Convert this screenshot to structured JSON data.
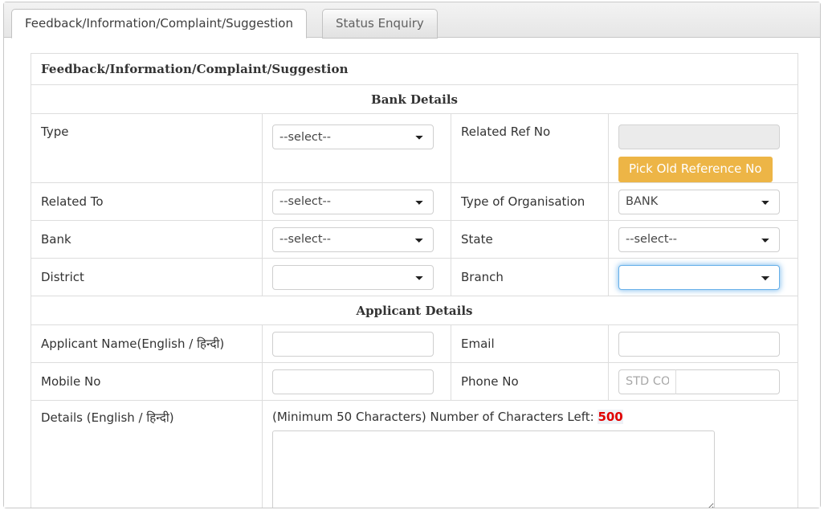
{
  "tabs": [
    {
      "label": "Feedback/Information/Complaint/Suggestion",
      "active": true
    },
    {
      "label": "Status Enquiry",
      "active": false
    }
  ],
  "form": {
    "title": "Feedback/Information/Complaint/Suggestion",
    "sections": {
      "bank_details": "Bank Details",
      "applicant_details": "Applicant Details"
    },
    "fields": {
      "type": {
        "label": "Type",
        "value": "--select--"
      },
      "related_ref_no": {
        "label": "Related Ref No",
        "value": "",
        "button": "Pick Old Reference No"
      },
      "related_to": {
        "label": "Related To",
        "value": "--select--"
      },
      "type_of_organisation": {
        "label": "Type of Organisation",
        "value": "BANK"
      },
      "bank": {
        "label": "Bank",
        "value": "--select--"
      },
      "state": {
        "label": "State",
        "value": "--select--"
      },
      "district": {
        "label": "District",
        "value": ""
      },
      "branch": {
        "label": "Branch",
        "value": ""
      },
      "applicant_name": {
        "label": "Applicant Name(English / हिन्दी)",
        "value": "",
        "placeholder": ""
      },
      "email": {
        "label": "Email",
        "value": "",
        "placeholder": ""
      },
      "mobile_no": {
        "label": "Mobile No",
        "value": "",
        "placeholder": ""
      },
      "phone_no": {
        "label": "Phone No",
        "std_placeholder": "STD CODE",
        "std_value": "",
        "value": "",
        "placeholder": ""
      },
      "details": {
        "label": "Details (English / हिन्दी)",
        "hint_prefix": "(Minimum 50 Characters) Number of Characters Left:",
        "characters_left": "500",
        "value": "",
        "placeholder": ""
      }
    }
  },
  "colors": {
    "accent_button": "#edb546",
    "focus_ring": "#66afe9",
    "counter_red": "#e00000"
  }
}
